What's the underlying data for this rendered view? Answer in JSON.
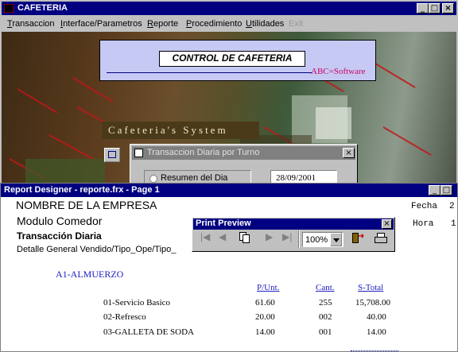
{
  "main_window": {
    "title": "CAFETERIA",
    "controls": [
      "_",
      "□",
      "×"
    ]
  },
  "menu": [
    {
      "label": "Transaccion",
      "accel": "T",
      "rest": "ransaccion"
    },
    {
      "label": "Interface/Parametros",
      "accel": "I",
      "rest": "nterface/Parametros"
    },
    {
      "label": "Reporte",
      "accel": "R",
      "rest": "eporte"
    },
    {
      "label": "Procedimiento",
      "accel": "P",
      "rest": "rocedimiento"
    },
    {
      "label": "Utilidades",
      "accel": "U",
      "rest": "tilidades"
    },
    {
      "label": "Exit",
      "disabled": true
    }
  ],
  "banner": {
    "title": "CONTROL DE CAFETERIA",
    "brand": "ABC=Software"
  },
  "system_label": "Cafeteria's System",
  "dialog": {
    "title": "Transaccion Diaria por Turno",
    "radio_label": "Resumen del Dia",
    "date_value": "28/09/2001"
  },
  "report_window": {
    "title": "Report Designer - reporte.frx - Page 1",
    "controls": [
      "_",
      "□",
      "×"
    ]
  },
  "report": {
    "company": "NOMBRE DE LA EMPRESA",
    "module": "Modulo Comedor",
    "transaction": "Transacción Diaria",
    "detail": "Detalle General Vendido/Tipo_Ope/Tipo_",
    "fecha_label": "Fecha",
    "fecha_value": "2",
    "hora_label": "Hora",
    "hora_value": "1",
    "group": "A1-ALMUERZO",
    "columns": {
      "price": "P/Unt.",
      "qty": "Cant.",
      "total": "S-Total"
    },
    "rows": [
      {
        "item": "01-Servicio Basico",
        "price": "61.60",
        "qty": "255",
        "total": "15,708.00"
      },
      {
        "item": "02-Refresco",
        "price": "20.00",
        "qty": "002",
        "total": "40.00"
      },
      {
        "item": "03-GALLETA DE SODA",
        "price": "14.00",
        "qty": "001",
        "total": "14.00"
      }
    ]
  },
  "print_preview": {
    "title": "Print Preview",
    "zoom": "100%"
  }
}
